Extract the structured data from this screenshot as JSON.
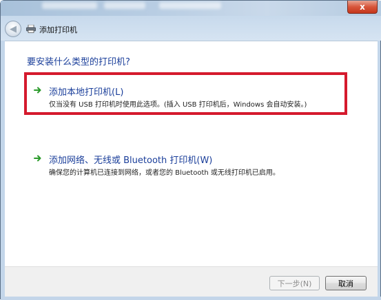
{
  "window": {
    "title": "添加打印机",
    "close_glyph": "x"
  },
  "nav": {
    "back_glyph": "◀"
  },
  "page": {
    "question": "要安装什么类型的打印机?"
  },
  "options": [
    {
      "title": "添加本地打印机(L)",
      "description": "仅当没有 USB 打印机时使用此选项。(插入 USB 打印机后，Windows 会自动安装。)",
      "icon": "green-arrow-icon"
    },
    {
      "title": "添加网络、无线或 Bluetooth 打印机(W)",
      "description": "确保您的计算机已连接到网络，或者您的 Bluetooth 或无线打印机已启用。",
      "icon": "green-arrow-icon"
    }
  ],
  "footer": {
    "next_label": "下一步(N)",
    "cancel_label": "取消"
  },
  "colors": {
    "link_blue": "#1a3e9a",
    "highlight_red": "#d51a2d",
    "arrow_green": "#2a9a2a"
  }
}
